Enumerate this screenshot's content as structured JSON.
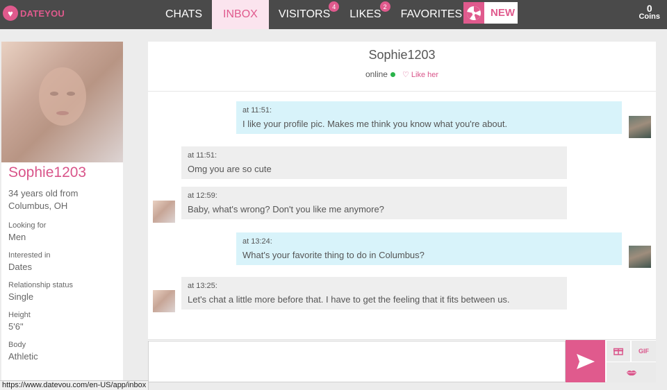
{
  "app": {
    "name": "DATEYOU"
  },
  "nav": {
    "items": [
      {
        "label": "CHATS"
      },
      {
        "label": "INBOX"
      },
      {
        "label": "VISITORS",
        "badge": "4"
      },
      {
        "label": "LIKES",
        "badge": "2"
      },
      {
        "label": "FAVORITES"
      }
    ],
    "active": "INBOX",
    "new_label": "NEW"
  },
  "coins": {
    "count": "0",
    "label": "Coins"
  },
  "profile": {
    "username": "Sophie1203",
    "age_line": "34 years old from",
    "location": "Columbus, OH",
    "attributes": [
      {
        "label": "Looking for",
        "value": "Men"
      },
      {
        "label": "Interested in",
        "value": "Dates"
      },
      {
        "label": "Relationship status",
        "value": "Single"
      },
      {
        "label": "Height",
        "value": "5'6\""
      },
      {
        "label": "Body",
        "value": "Athletic"
      }
    ]
  },
  "chat": {
    "name": "Sophie1203",
    "status": "online",
    "like_label": "Like her",
    "messages": [
      {
        "direction": "out",
        "time": "at 11:51:",
        "text": "I like your profile pic. Makes me think you know what you're about."
      },
      {
        "direction": "in",
        "time": "at 11:51:",
        "text": "Omg you are so cute"
      },
      {
        "direction": "in",
        "time": "at 12:59:",
        "text": "Baby, what's wrong? Don't you like me anymore?"
      },
      {
        "direction": "out",
        "time": "at 13:24:",
        "text": "What's your favorite thing to do in Columbus?"
      },
      {
        "direction": "in",
        "time": "at 13:25:",
        "text": "Let's chat a little more before that. I have to get the feeling that it fits between us."
      }
    ],
    "gif_label": "GIF"
  },
  "statusbar": {
    "url": "https://www.datevou.com/en-US/app/inbox"
  },
  "colors": {
    "accent": "#e05a8d",
    "topbar": "#4a4a4a",
    "outgoing": "#d8f3fa",
    "incoming": "#eeeeee",
    "online": "#2ab34a"
  }
}
